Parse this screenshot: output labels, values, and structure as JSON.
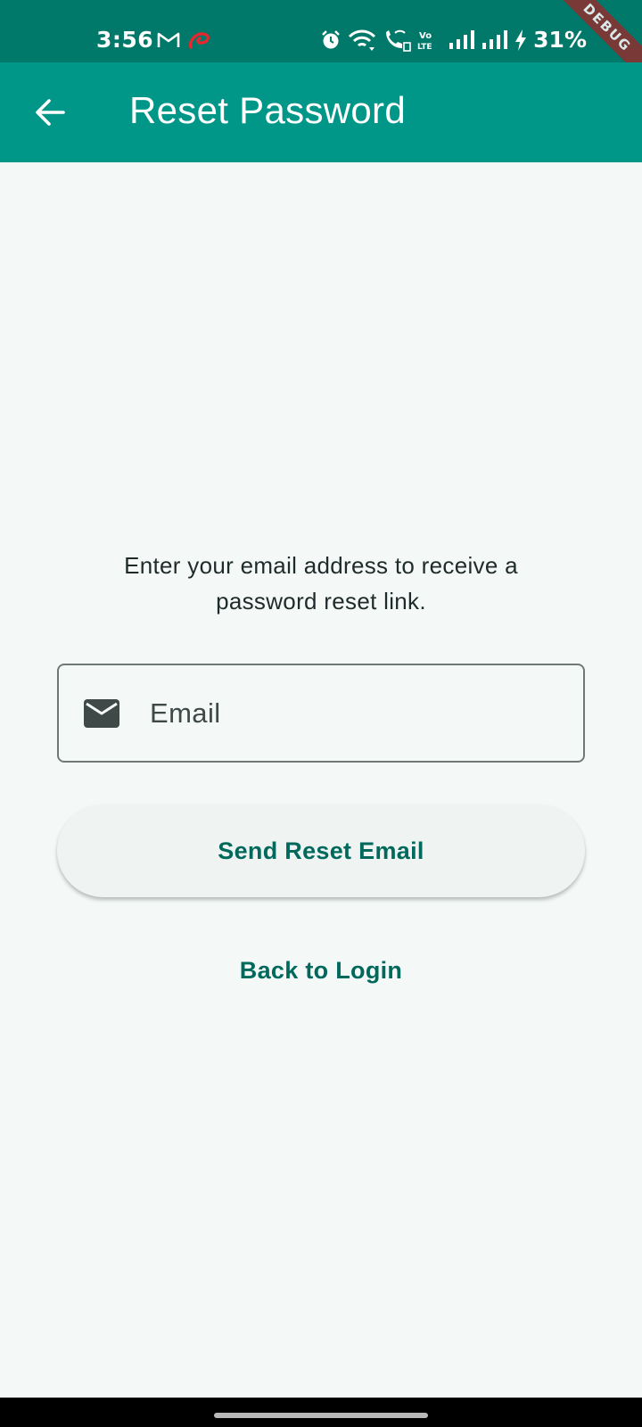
{
  "status_bar": {
    "time": "3:56",
    "battery_percent": "31%",
    "debug_label": "DEBUG",
    "left_icons": [
      "gmail-icon",
      "airtel-icon"
    ],
    "right_icons": [
      "alarm-icon",
      "wifi-icon",
      "wifi-calling-icon",
      "volte-icon",
      "signal-icon",
      "signal-icon",
      "charging-icon"
    ],
    "colors": {
      "background": "#00796b",
      "debug_banner": "#8f2e2e"
    }
  },
  "app_bar": {
    "title": "Reset Password",
    "back_icon": "arrow-back-icon",
    "colors": {
      "background": "#009688",
      "foreground": "#ffffff"
    }
  },
  "content": {
    "instruction": "Enter your email address to receive a password reset link.",
    "email_field": {
      "placeholder": "Email",
      "value": "",
      "icon": "email-icon"
    },
    "send_button_label": "Send Reset Email",
    "back_to_login_label": "Back to Login",
    "colors": {
      "accent": "#00695c",
      "background": "#f4f9f8",
      "outline": "#707977"
    }
  }
}
